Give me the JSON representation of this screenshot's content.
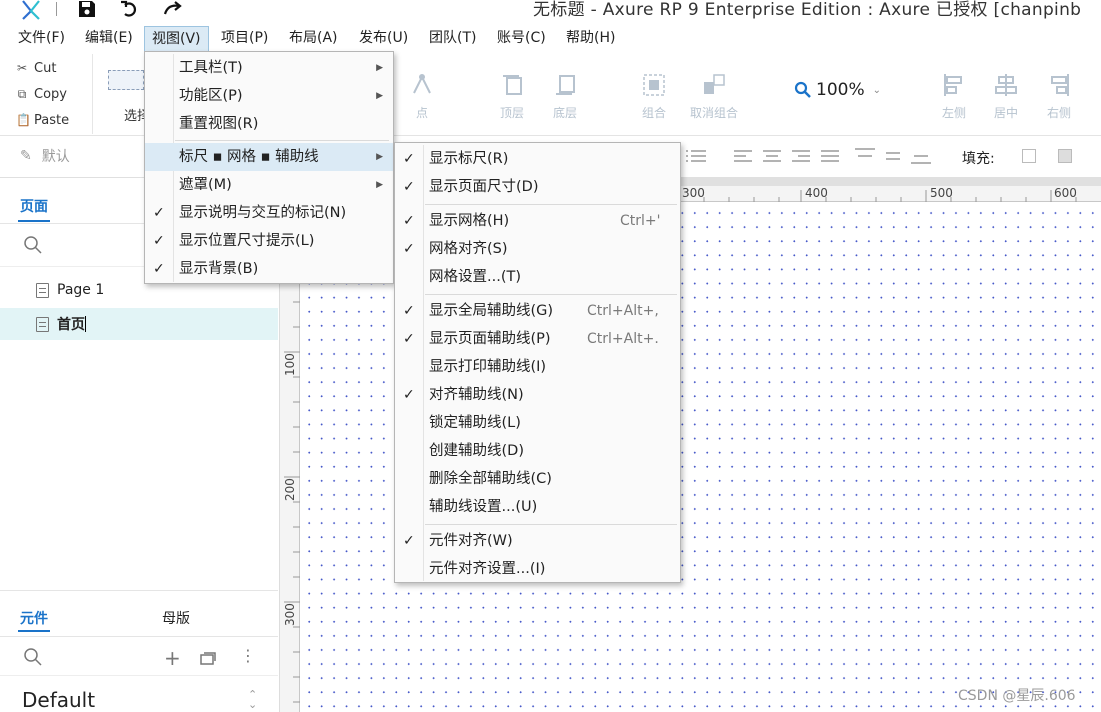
{
  "window": {
    "title": "无标题 - Axure RP 9 Enterprise Edition : Axure 已授权    [chanpinb"
  },
  "menubar": [
    "文件(F)",
    "编辑(E)",
    "视图(V)",
    "项目(P)",
    "布局(A)",
    "发布(U)",
    "团队(T)",
    "账号(C)",
    "帮助(H)"
  ],
  "toolbar": {
    "clipboard": [
      "Cut",
      "Copy",
      "Paste"
    ],
    "select_label": "选择",
    "tools": {
      "point": "点",
      "top_layer": "顶层",
      "bottom_layer": "底层",
      "group": "组合",
      "ungroup": "取消组合",
      "align_left": "左侧",
      "align_center": "居中",
      "align_right": "右侧"
    },
    "zoom": "100%"
  },
  "toolbar2": {
    "style_default": "默认",
    "fill_label": "填充:"
  },
  "left_panel": {
    "pages_tab": "页面",
    "pages": [
      {
        "name": "Page 1"
      },
      {
        "name": "首页"
      }
    ],
    "widgets_tab": "元件",
    "masters_tab": "母版",
    "library_select": "Default"
  },
  "ruler": {
    "top": [
      "300",
      "400",
      "500",
      "600"
    ],
    "left": [
      "100",
      "200",
      "300"
    ]
  },
  "view_menu": {
    "items": [
      {
        "label": "工具栏(T)",
        "submenu": true,
        "checked": false
      },
      {
        "label": "功能区(P)",
        "submenu": true,
        "checked": false
      },
      {
        "label": "重置视图(R)",
        "submenu": false,
        "checked": false
      },
      {
        "label": "标尺 ▪ 网格 ▪ 辅助线",
        "submenu": true,
        "checked": false,
        "highlighted": true
      },
      {
        "label": "遮罩(M)",
        "submenu": true,
        "checked": false
      },
      {
        "label": "显示说明与交互的标记(N)",
        "submenu": false,
        "checked": true
      },
      {
        "label": "显示位置尺寸提示(L)",
        "submenu": false,
        "checked": true
      },
      {
        "label": "显示背景(B)",
        "submenu": false,
        "checked": true
      }
    ]
  },
  "grid_submenu": {
    "items": [
      {
        "label": "显示标尺(R)",
        "checked": true,
        "shortcut": ""
      },
      {
        "label": "显示页面尺寸(D)",
        "checked": true,
        "shortcut": ""
      },
      {
        "label": "显示网格(H)",
        "checked": true,
        "shortcut": "Ctrl+'"
      },
      {
        "label": "网格对齐(S)",
        "checked": true,
        "shortcut": ""
      },
      {
        "label": "网格设置...(T)",
        "checked": false,
        "shortcut": ""
      },
      {
        "label": "显示全局辅助线(G)",
        "checked": true,
        "shortcut": "Ctrl+Alt+,"
      },
      {
        "label": "显示页面辅助线(P)",
        "checked": true,
        "shortcut": "Ctrl+Alt+."
      },
      {
        "label": "显示打印辅助线(I)",
        "checked": false,
        "shortcut": ""
      },
      {
        "label": "对齐辅助线(N)",
        "checked": true,
        "shortcut": ""
      },
      {
        "label": "锁定辅助线(L)",
        "checked": false,
        "shortcut": ""
      },
      {
        "label": "创建辅助线(D)",
        "checked": false,
        "shortcut": ""
      },
      {
        "label": "删除全部辅助线(C)",
        "checked": false,
        "shortcut": ""
      },
      {
        "label": "辅助线设置...(U)",
        "checked": false,
        "shortcut": ""
      },
      {
        "label": "元件对齐(W)",
        "checked": true,
        "shortcut": ""
      },
      {
        "label": "元件对齐设置...(I)",
        "checked": false,
        "shortcut": ""
      }
    ]
  },
  "watermark": "CSDN @星辰.606",
  "colors": {
    "menu_highlight": "#dbeaf5",
    "selected_page": "#e2f4f6",
    "accent": "#1a73c9",
    "grid_dot": "#4658c9"
  }
}
